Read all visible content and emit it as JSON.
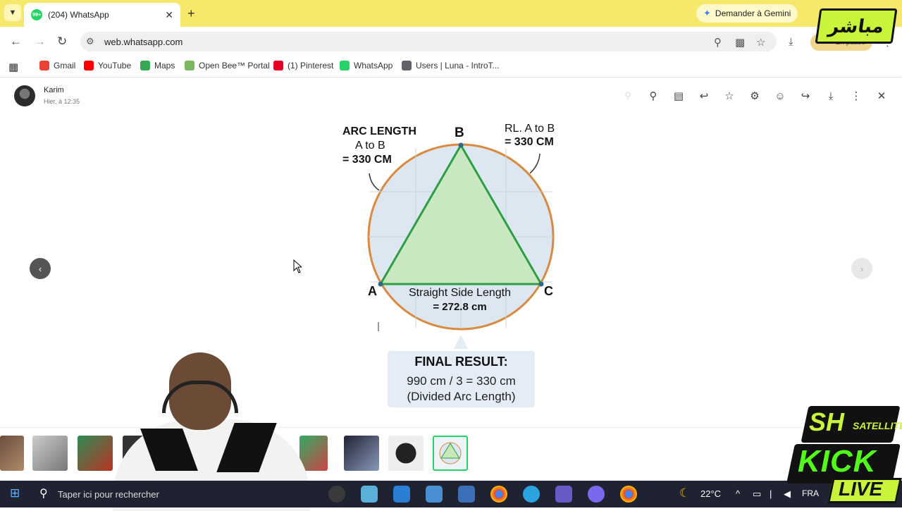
{
  "browser": {
    "tab_title": "(204) WhatsApp",
    "tab_badge": "99+",
    "gemini_label": "Demander à Gemini",
    "url": "web.whatsapp.com",
    "profile_label": "En pause"
  },
  "bookmarks": [
    {
      "label": "Gmail",
      "icon": "gmail-icon",
      "color": "#ea4335"
    },
    {
      "label": "YouTube",
      "icon": "youtube-icon",
      "color": "#ff0000"
    },
    {
      "label": "Maps",
      "icon": "maps-icon",
      "color": "#34a853"
    },
    {
      "label": "Open Bee™ Portal",
      "icon": "openbee-icon",
      "color": "#7bb661"
    },
    {
      "label": "(1) Pinterest",
      "icon": "pinterest-icon",
      "color": "#e60023"
    },
    {
      "label": "WhatsApp",
      "icon": "whatsapp-icon",
      "color": "#25d366"
    },
    {
      "label": "Users | Luna - IntroT...",
      "icon": "table-icon",
      "color": "#5f6368"
    }
  ],
  "viewer": {
    "sender": "Karim",
    "time": "Hier, à 12:35"
  },
  "diagram": {
    "arc_title": "ARC LENGTH",
    "arc_line2": "A to B",
    "arc_line3": "= 330 CM",
    "rl_line1": "RL. A to B",
    "rl_line2": "= 330 CM",
    "point_a": "A",
    "point_b": "B",
    "point_c": "C",
    "side_line1": "Straight Side Length",
    "side_line2": "= 272.8 cm",
    "final_title": "FINAL RESULT:",
    "final_line1": "990 cm / 3 = 330 cm",
    "final_line2": "(Divided Arc Length)",
    "colors": {
      "circle": "#d98a3f",
      "triangle": "#2e9e46",
      "fill": "#c6e7b8",
      "disc": "#dde7f1"
    }
  },
  "taskbar": {
    "search_placeholder": "Taper ici pour rechercher",
    "weather": "22°C",
    "language": "FRA"
  },
  "overlay": {
    "channel_logo": "مباشر",
    "brand_line1": "SH",
    "brand_line2": "SATELLITE",
    "brand_line3": "KICK",
    "brand_line4": "LIVE"
  }
}
